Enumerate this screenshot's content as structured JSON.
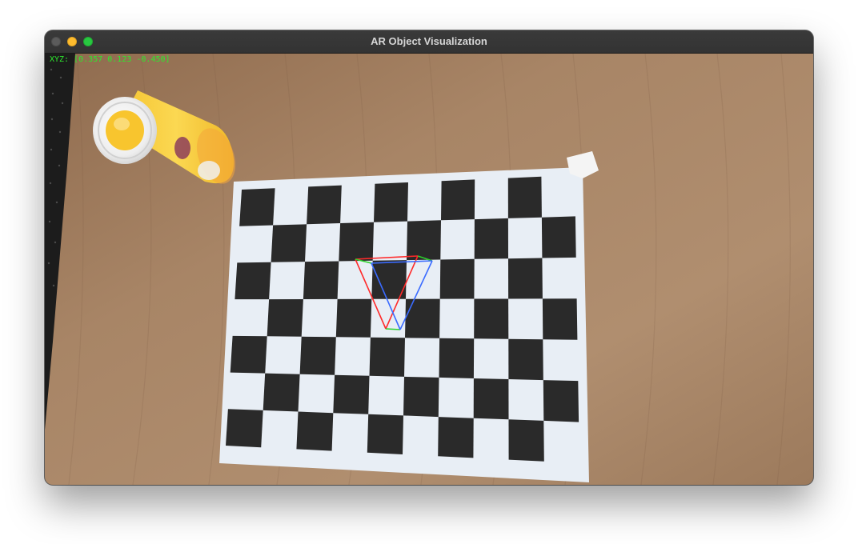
{
  "window": {
    "title": "AR Object Visualization"
  },
  "overlay": {
    "label": "XYZ:",
    "coords": "[0.357 0.123 -0.450]"
  },
  "scene": {
    "chessboard_rows": 7,
    "chessboard_cols": 10,
    "axis_colors": {
      "x": "#ff2a2a",
      "y": "#2bd12b",
      "z": "#3a6bff"
    },
    "wood_color": "#a88566",
    "paper_color": "#e8eef5",
    "square_color": "#2a2a2a",
    "bottle_cap_color": "#f2f2f2",
    "bottle_body_color": "#f7cd3a"
  }
}
